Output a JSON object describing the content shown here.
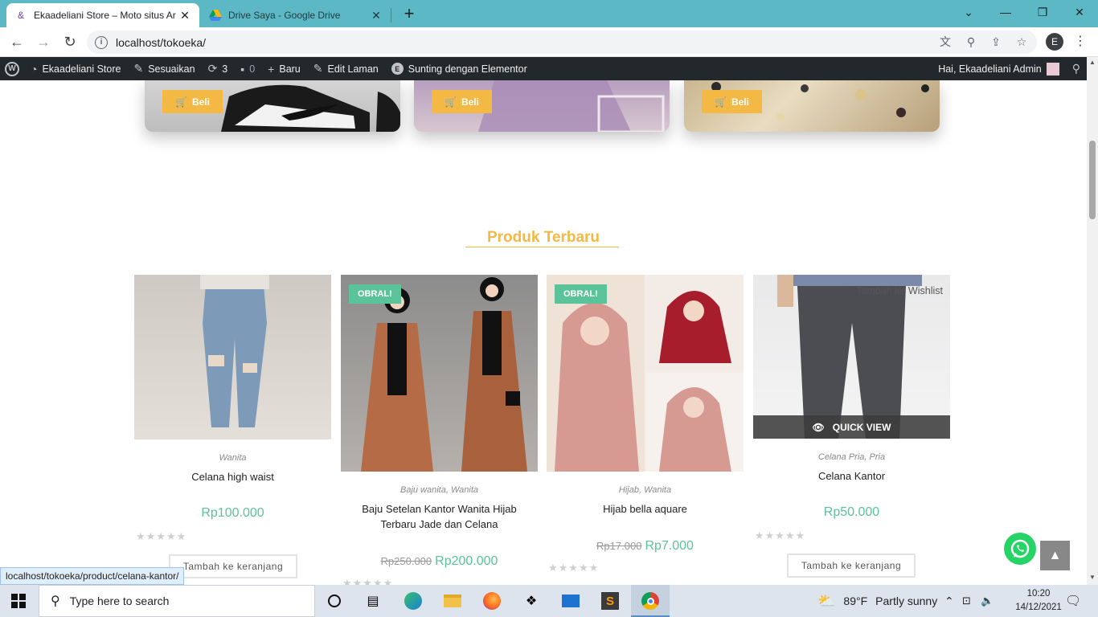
{
  "browser": {
    "tabs": [
      {
        "title": "Ekaadeliani Store – Moto situs Ar",
        "active": true
      },
      {
        "title": "Drive Saya - Google Drive",
        "active": false
      }
    ],
    "url": "localhost/tokoeka/",
    "profile_initial": "E"
  },
  "admin_bar": {
    "site_name": "Ekaadeliani Store",
    "customize": "Sesuaikan",
    "updates_count": "3",
    "comments_count": "0",
    "new": "Baru",
    "edit_page": "Edit Laman",
    "elementor": "Sunting dengan Elementor",
    "greeting": "Hai, Ekaadeliani Admin"
  },
  "categories": [
    {
      "button": "Beli",
      "image": "sneakers"
    },
    {
      "button": "Beli",
      "image": "dress"
    },
    {
      "button": "Beli",
      "image": "accessories"
    }
  ],
  "section": {
    "title": "Produk Terbaru"
  },
  "products": [
    {
      "category": "Wanita",
      "name": "Celana high waist",
      "old_price": "",
      "price": "Rp100.000",
      "badge": "",
      "button": "Tambah ke keranjang",
      "image": "jeans"
    },
    {
      "category": "Baju wanita, Wanita",
      "name": "Baju Setelan Kantor Wanita Hijab Terbaru Jade dan Celana",
      "old_price": "Rp250.000",
      "price": "Rp200.000",
      "badge": "OBRAL!",
      "button": "",
      "image": "office-set"
    },
    {
      "category": "Hijab, Wanita",
      "name": "Hijab bella aquare",
      "old_price": "Rp17.000",
      "price": "Rp7.000",
      "badge": "OBRAL!",
      "button": "",
      "image": "hijab"
    },
    {
      "category": "Celana Pria, Pria",
      "name": "Celana Kantor",
      "old_price": "",
      "price": "Rp50.000",
      "badge": "",
      "button": "Tambah ke keranjang",
      "image": "trousers",
      "wishlist": "Tambah ke Wishlist",
      "quick_view": "QUICK VIEW"
    }
  ],
  "status_url": "localhost/tokoeka/product/celana-kantor/",
  "taskbar": {
    "search_placeholder": "Type here to search",
    "weather_temp": "89°F",
    "weather_text": "Partly sunny",
    "time": "10:20",
    "date": "14/12/2021"
  },
  "colors": {
    "accent": "#f4b844",
    "price": "#5ac39a",
    "adminbar": "#23282d",
    "tabstrip": "#5cb8c4"
  }
}
